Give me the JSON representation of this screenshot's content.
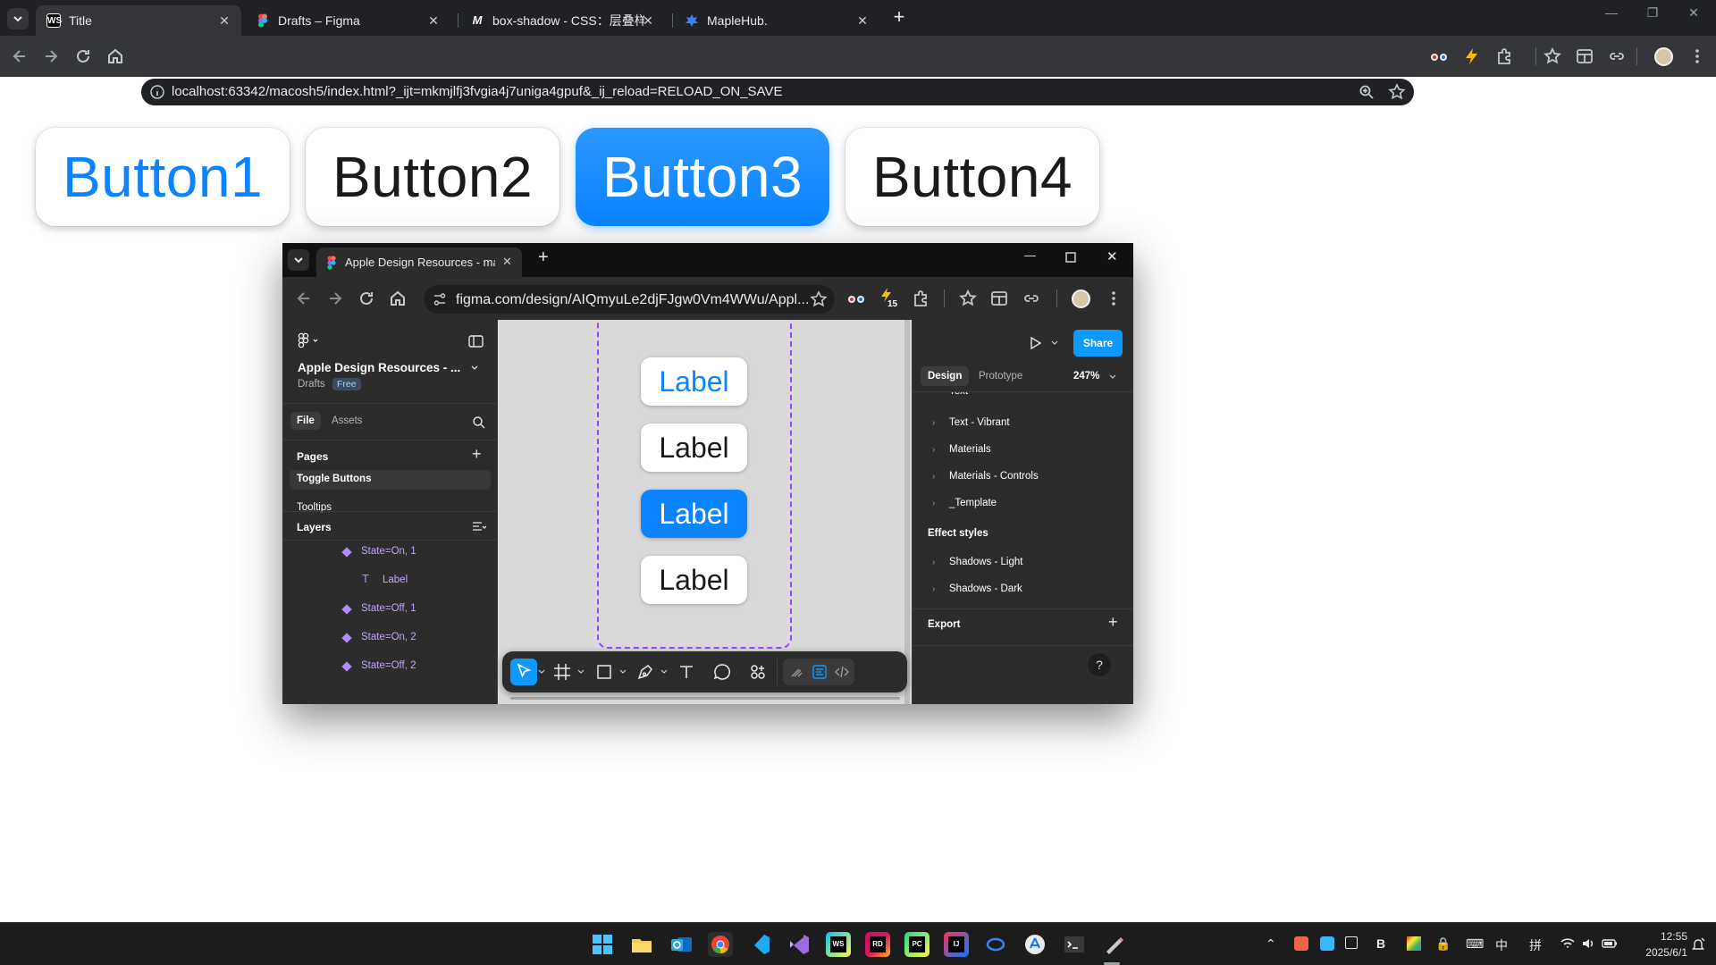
{
  "browser": {
    "tabs": [
      {
        "title": "Title",
        "active": true,
        "favicon": "webstorm-icon"
      },
      {
        "title": "Drafts – Figma",
        "active": false,
        "favicon": "figma-icon"
      },
      {
        "title": "box-shadow - CSS：层叠样式",
        "active": false,
        "favicon": "mdn-icon"
      },
      {
        "title": "MapleHub.",
        "active": false,
        "favicon": "maplehub-icon"
      }
    ],
    "url": "localhost:63342/macosh5/index.html?_ijt=mkmjlfj3fvgia4j7uniga4gpuf&_ij_reload=RELOAD_ON_SAVE"
  },
  "page": {
    "buttons": [
      "Button1",
      "Button2",
      "Button3",
      "Button4"
    ]
  },
  "inner": {
    "tab_title": "Apple Design Resources - ma",
    "url": "figma.com/design/AIQmyuLe2djFJgw0Vm4WWu/Appl...",
    "ext_badge": "15",
    "file_title": "Apple Design Resources - ...",
    "drafts": "Drafts",
    "free_badge": "Free",
    "file_tab": "File",
    "assets_tab": "Assets",
    "pages_heading": "Pages",
    "pages": [
      "Toggle Buttons",
      "Tooltips"
    ],
    "layers_heading": "Layers",
    "layers": [
      {
        "name": "State=On, 1",
        "type": "component"
      },
      {
        "name": "Label",
        "type": "text"
      },
      {
        "name": "State=Off, 1",
        "type": "component"
      },
      {
        "name": "State=On, 2",
        "type": "component"
      },
      {
        "name": "State=Off, 2",
        "type": "component"
      }
    ],
    "canvas_labels": [
      "Label",
      "Label",
      "Label",
      "Label"
    ],
    "share": "Share",
    "design_tab": "Design",
    "prototype_tab": "Prototype",
    "zoom": "247%",
    "partial_style": "Text",
    "styles": [
      "Text - Vibrant",
      "Materials",
      "Materials - Controls",
      "_Template"
    ],
    "effect_heading": "Effect styles",
    "effects": [
      "Shadows - Light",
      "Shadows - Dark"
    ],
    "export_heading": "Export",
    "help": "?"
  },
  "taskbar": {
    "time": "12:55",
    "date": "2025/6/1",
    "ime_lang": "中",
    "ime_mode": "拼"
  },
  "colors": {
    "accent": "#0a84ff",
    "figma_purple": "#9747ff",
    "share_blue": "#0d99ff"
  }
}
